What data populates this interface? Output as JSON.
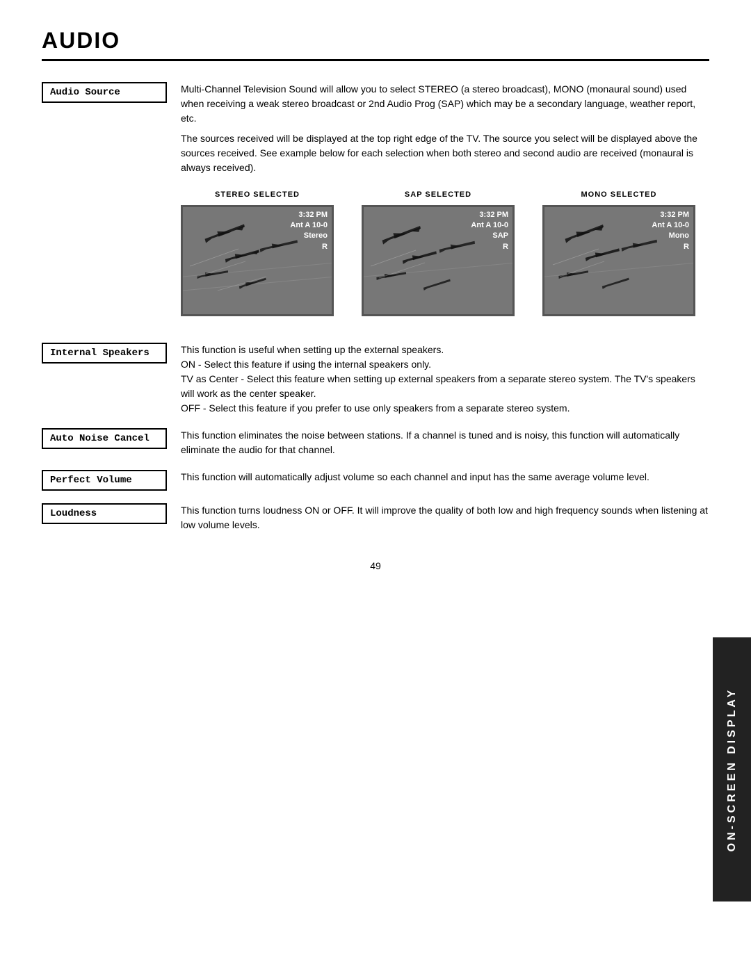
{
  "page": {
    "title": "AUDIO",
    "page_number": "49",
    "sidebar": {
      "line1": "ON-SCREEN DISPLAY"
    }
  },
  "features": [
    {
      "id": "audio-source",
      "label": "Audio Source",
      "paragraphs": [
        "Multi-Channel Television Sound will allow you to select STEREO (a stereo broadcast), MONO (monaural sound) used when receiving a weak stereo broadcast or 2nd Audio Prog (SAP) which may be a secondary language, weather report, etc.",
        "The sources received will be displayed at the top right edge of the TV.  The source you select will be displayed above the sources received.  See example below for each selection when both stereo and second audio are received (monaural is always received)."
      ],
      "has_screens": true
    },
    {
      "id": "internal-speakers",
      "label": "Internal Speakers",
      "paragraphs": [
        "This function is useful when setting up the external speakers.",
        "ON - Select this feature if using the internal speakers only.",
        "TV as Center - Select this feature when setting up external speakers from a separate stereo system.  The TV's speakers will work as the center speaker.",
        "OFF - Select this feature if you prefer to use only speakers from a separate stereo system."
      ],
      "has_screens": false
    },
    {
      "id": "auto-noise-cancel",
      "label": "Auto Noise Cancel",
      "paragraphs": [
        "This function eliminates the noise between stations. If a channel is tuned and is noisy, this function will automatically eliminate the audio for that channel."
      ],
      "has_screens": false
    },
    {
      "id": "perfect-volume",
      "label": "Perfect Volume",
      "paragraphs": [
        "This function will automatically adjust volume so each channel  and input has the same average volume level."
      ],
      "has_screens": false
    },
    {
      "id": "loudness",
      "label": "Loudness",
      "paragraphs": [
        "This function turns loudness ON or OFF.  It will improve the quality of both low and high frequency sounds when listening at low volume levels."
      ],
      "has_screens": false
    }
  ],
  "screens": [
    {
      "label": "STEREO SELECTED",
      "overlay_lines": [
        "3:32 PM",
        "Ant A 10-0",
        "Stereo",
        "R"
      ]
    },
    {
      "label": "SAP SELECTED",
      "overlay_lines": [
        "3:32 PM",
        "Ant A 10-0",
        "SAP",
        "R"
      ]
    },
    {
      "label": "MONO SELECTED",
      "overlay_lines": [
        "3:32 PM",
        "Ant A 10-0",
        "Mono",
        "R"
      ]
    }
  ]
}
